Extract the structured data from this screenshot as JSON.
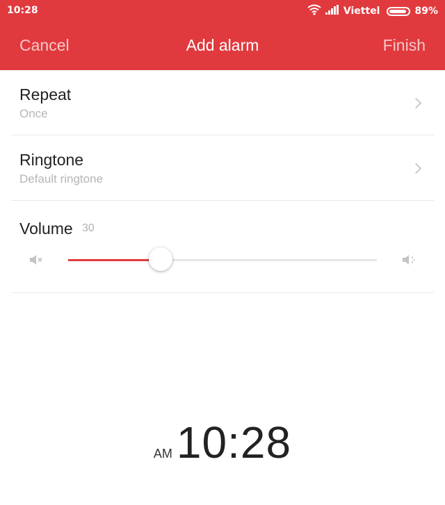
{
  "status_bar": {
    "time": "10:28",
    "carrier": "Viettel",
    "battery_percent": "89%",
    "battery_level": 0.89,
    "icons": [
      "wifi-icon",
      "signal-icon",
      "battery-icon"
    ]
  },
  "toolbar": {
    "cancel_label": "Cancel",
    "title": "Add alarm",
    "finish_label": "Finish"
  },
  "settings": {
    "repeat": {
      "label": "Repeat",
      "value": "Once"
    },
    "ringtone": {
      "label": "Ringtone",
      "value": "Default ringtone"
    },
    "volume": {
      "label": "Volume",
      "value": "30",
      "level": 0.3
    }
  },
  "time_picker": {
    "ampm": "AM",
    "time": "10:28"
  },
  "colors": {
    "accent": "#e03a3e",
    "divider": "#e8e8e8",
    "secondary_text": "#b5b5b5"
  }
}
